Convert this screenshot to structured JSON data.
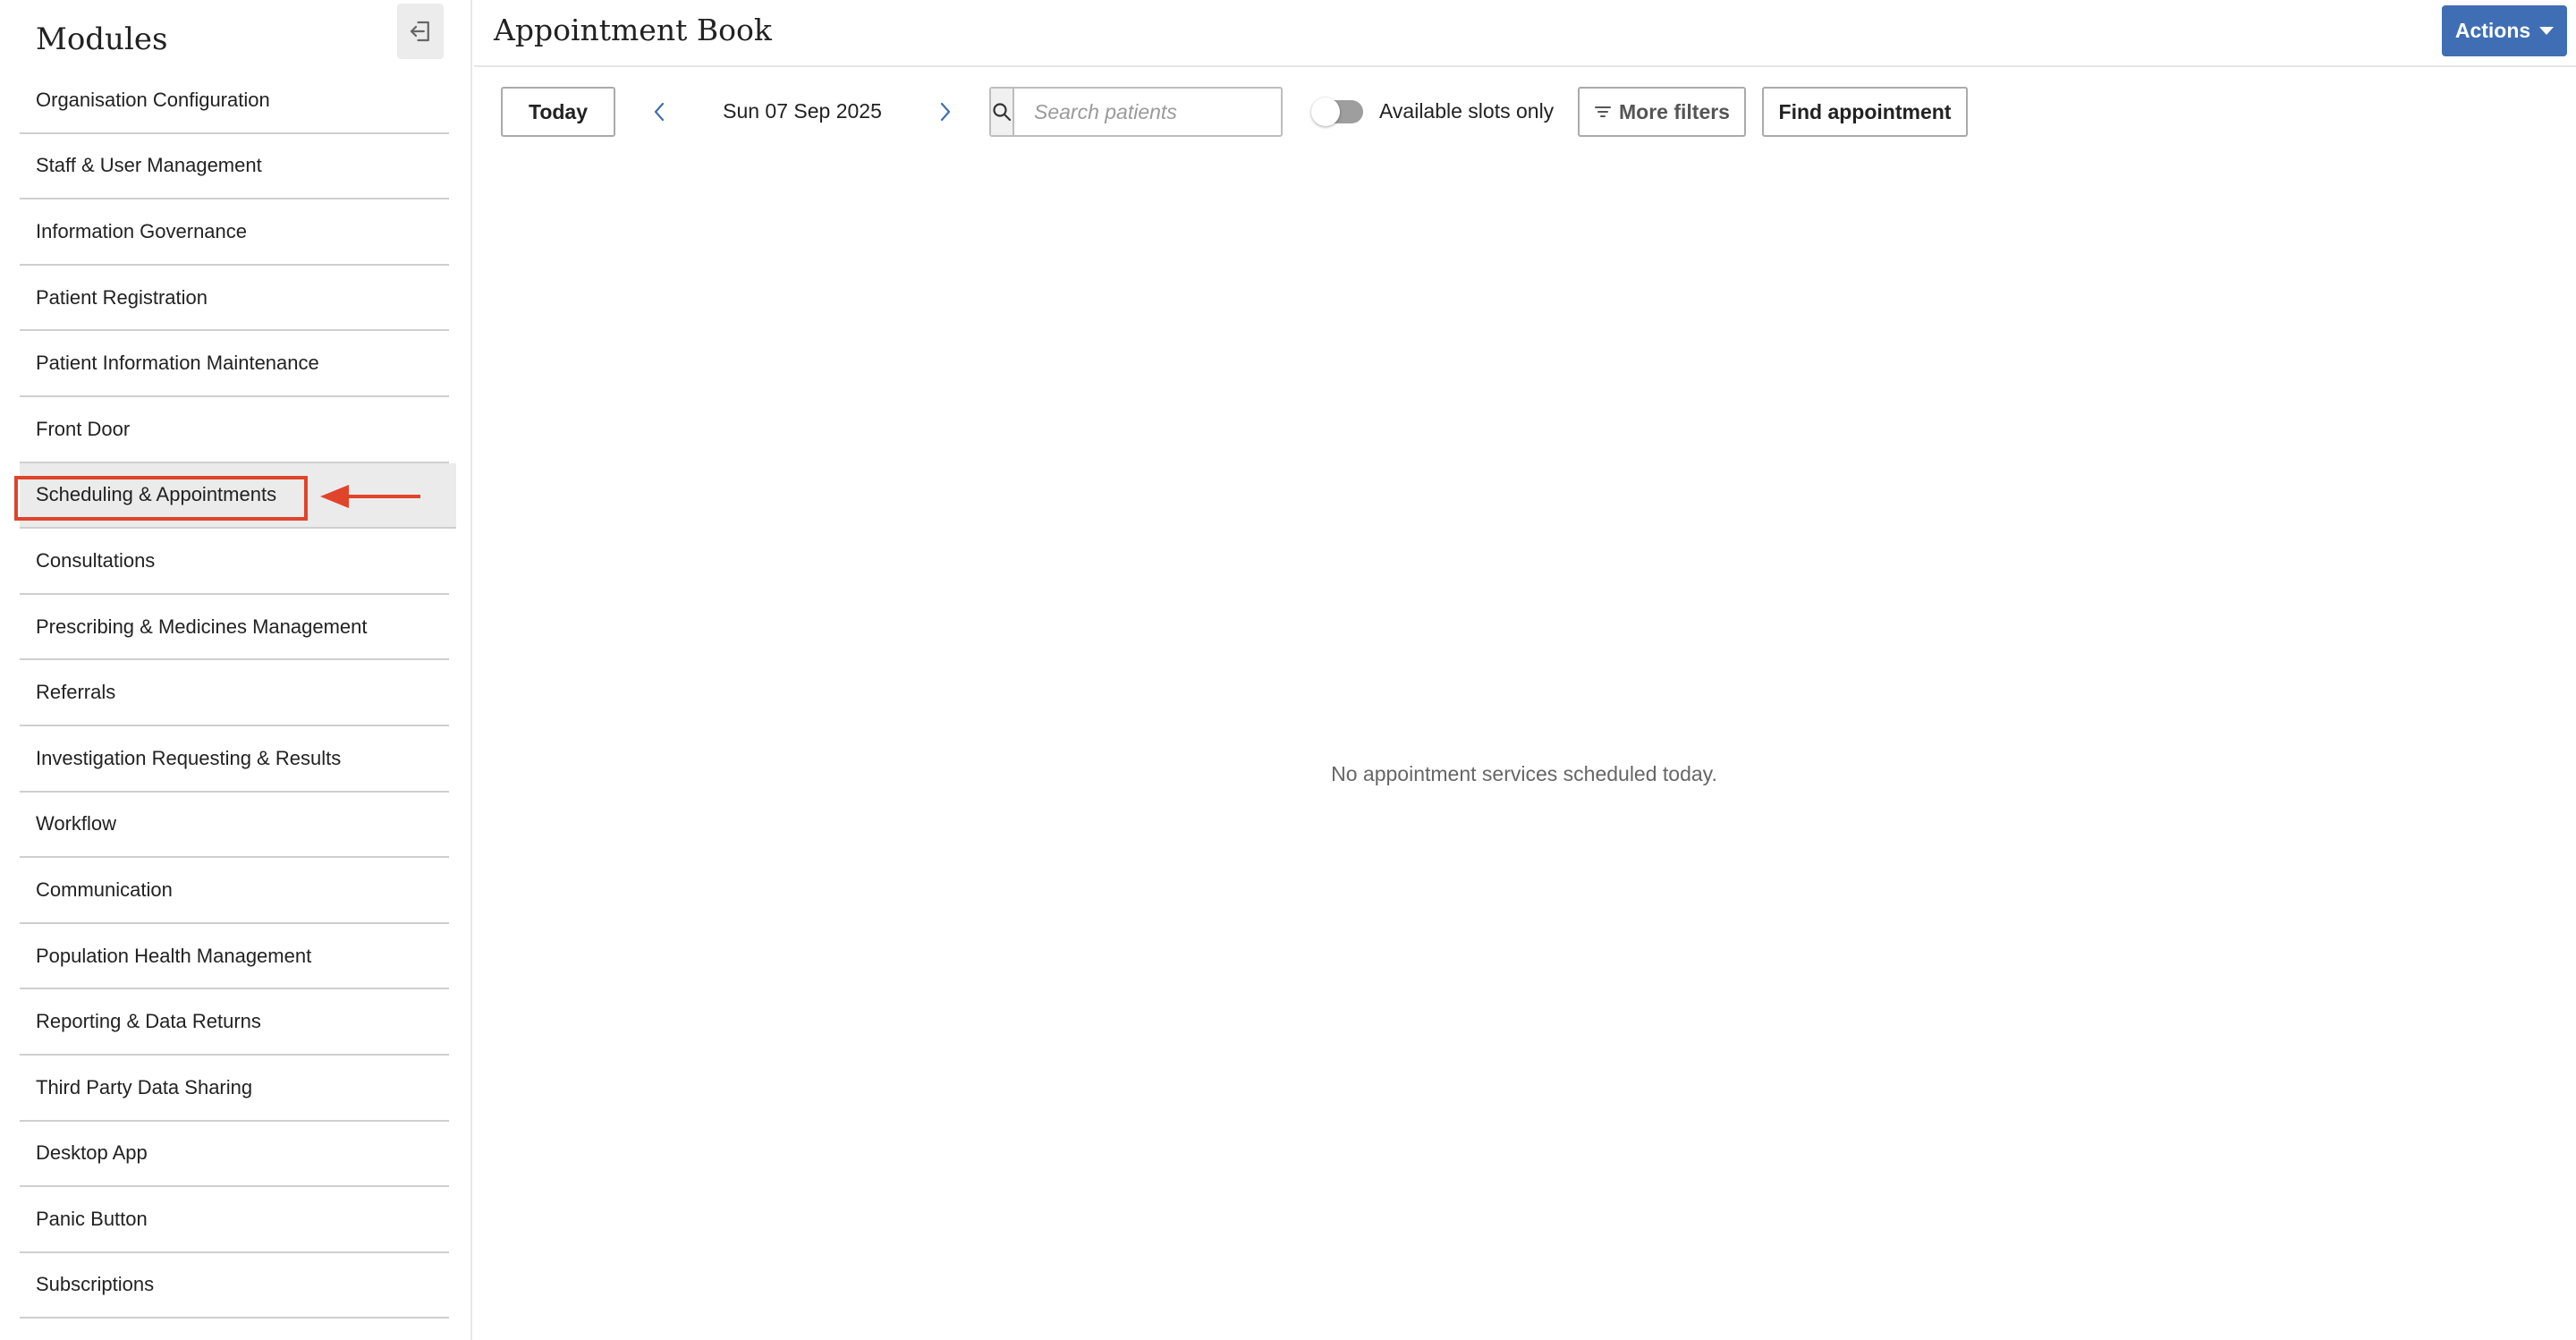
{
  "sidebar": {
    "title": "Modules",
    "items": [
      {
        "label": "Organisation Configuration"
      },
      {
        "label": "Staff & User Management"
      },
      {
        "label": "Information Governance"
      },
      {
        "label": "Patient Registration"
      },
      {
        "label": "Patient Information Maintenance"
      },
      {
        "label": "Front Door"
      },
      {
        "label": "Scheduling & Appointments",
        "active": true
      },
      {
        "label": "Consultations"
      },
      {
        "label": "Prescribing & Medicines Management"
      },
      {
        "label": "Referrals"
      },
      {
        "label": "Investigation Requesting & Results"
      },
      {
        "label": "Workflow"
      },
      {
        "label": "Communication"
      },
      {
        "label": "Population Health Management"
      },
      {
        "label": "Reporting & Data Returns"
      },
      {
        "label": "Third Party Data Sharing"
      },
      {
        "label": "Desktop App"
      },
      {
        "label": "Panic Button"
      },
      {
        "label": "Subscriptions"
      }
    ]
  },
  "header": {
    "title": "Appointment Book",
    "actions_label": "Actions"
  },
  "toolbar": {
    "today_label": "Today",
    "date": "Sun 07 Sep 2025",
    "search_placeholder": "Search patients",
    "toggle_label": "Available slots only",
    "toggle_on": false,
    "more_filters_label": "More filters",
    "find_label": "Find appointment"
  },
  "main": {
    "empty_message": "No appointment services scheduled today."
  },
  "colors": {
    "primary": "#3f6eb5",
    "annotation": "#e0442b"
  }
}
